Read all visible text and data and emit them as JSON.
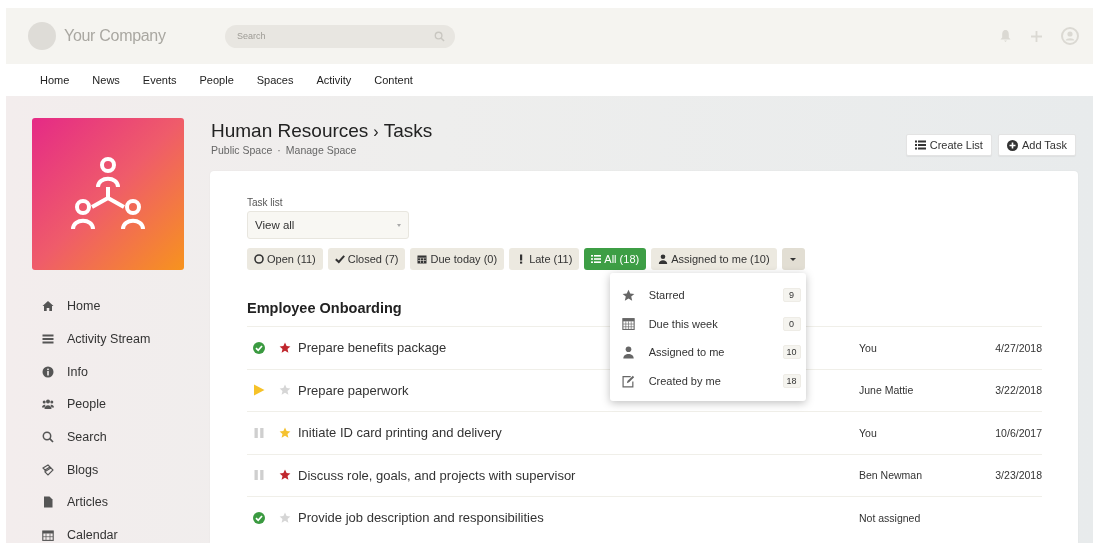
{
  "header": {
    "company": "Your Company",
    "search": {
      "placeholder": "Search"
    }
  },
  "nav": [
    "Home",
    "News",
    "Events",
    "People",
    "Spaces",
    "Activity",
    "Content"
  ],
  "sidebar": {
    "items": [
      {
        "label": "Home",
        "kind": "home"
      },
      {
        "label": "Activity Stream",
        "kind": "list"
      },
      {
        "label": "Info",
        "kind": "info"
      },
      {
        "label": "People",
        "kind": "people"
      },
      {
        "label": "Search",
        "kind": "search"
      },
      {
        "label": "Blogs",
        "kind": "blogs"
      },
      {
        "label": "Articles",
        "kind": "file"
      },
      {
        "label": "Calendar",
        "kind": "calendar"
      }
    ]
  },
  "page": {
    "breadcrumb": [
      "Human Resources",
      "›",
      "Tasks"
    ],
    "links": [
      "Public Space",
      "·",
      "Manage Space"
    ],
    "buttons": [
      {
        "label": "Create List",
        "kind": "list"
      },
      {
        "label": "Add Task",
        "kind": "plus"
      }
    ]
  },
  "task_list": {
    "label": "Task list",
    "value": "View all"
  },
  "filters": [
    {
      "label": "Open (11)",
      "kind": "circle",
      "selected": false
    },
    {
      "label": "Closed (7)",
      "kind": "check",
      "selected": false
    },
    {
      "label": "Due today (0)",
      "kind": "calendar",
      "selected": false
    },
    {
      "label": "Late (11)",
      "kind": "bang",
      "selected": false
    },
    {
      "label": "All (18)",
      "kind": "list",
      "selected": true
    },
    {
      "label": "Assigned to me (10)",
      "kind": "user",
      "selected": false
    }
  ],
  "menu": {
    "expanded": true,
    "items": [
      {
        "label": "Starred",
        "kind": "star",
        "count": "9"
      },
      {
        "label": "Due this week",
        "kind": "calendar",
        "count": "0"
      },
      {
        "label": "Assigned to me",
        "kind": "user",
        "count": "10"
      },
      {
        "label": "Created by me",
        "kind": "edit",
        "count": "18"
      }
    ]
  },
  "group": "Employee Onboarding",
  "tasks": [
    {
      "kind": "done",
      "starred": true,
      "color": "#c0262d",
      "title": "Prepare benefits package",
      "assignee": "You",
      "date": "4/27/2018"
    },
    {
      "kind": "active",
      "starred": false,
      "title": "Prepare paperwork",
      "assignee": "June Mattie",
      "date": "3/22/2018"
    },
    {
      "kind": "paused",
      "starred": true,
      "color": "#f5c230",
      "title": "Initiate ID card printing and delivery",
      "assignee": "You",
      "date": "10/6/2017"
    },
    {
      "kind": "paused",
      "starred": true,
      "color": "#c0262d",
      "title": "Discuss role, goals, and projects with supervisor",
      "assignee": "Ben Newman",
      "date": "3/23/2018"
    },
    {
      "kind": "done",
      "starred": false,
      "title": "Provide job description and responsibilities",
      "assignee": "Not assigned"
    }
  ]
}
